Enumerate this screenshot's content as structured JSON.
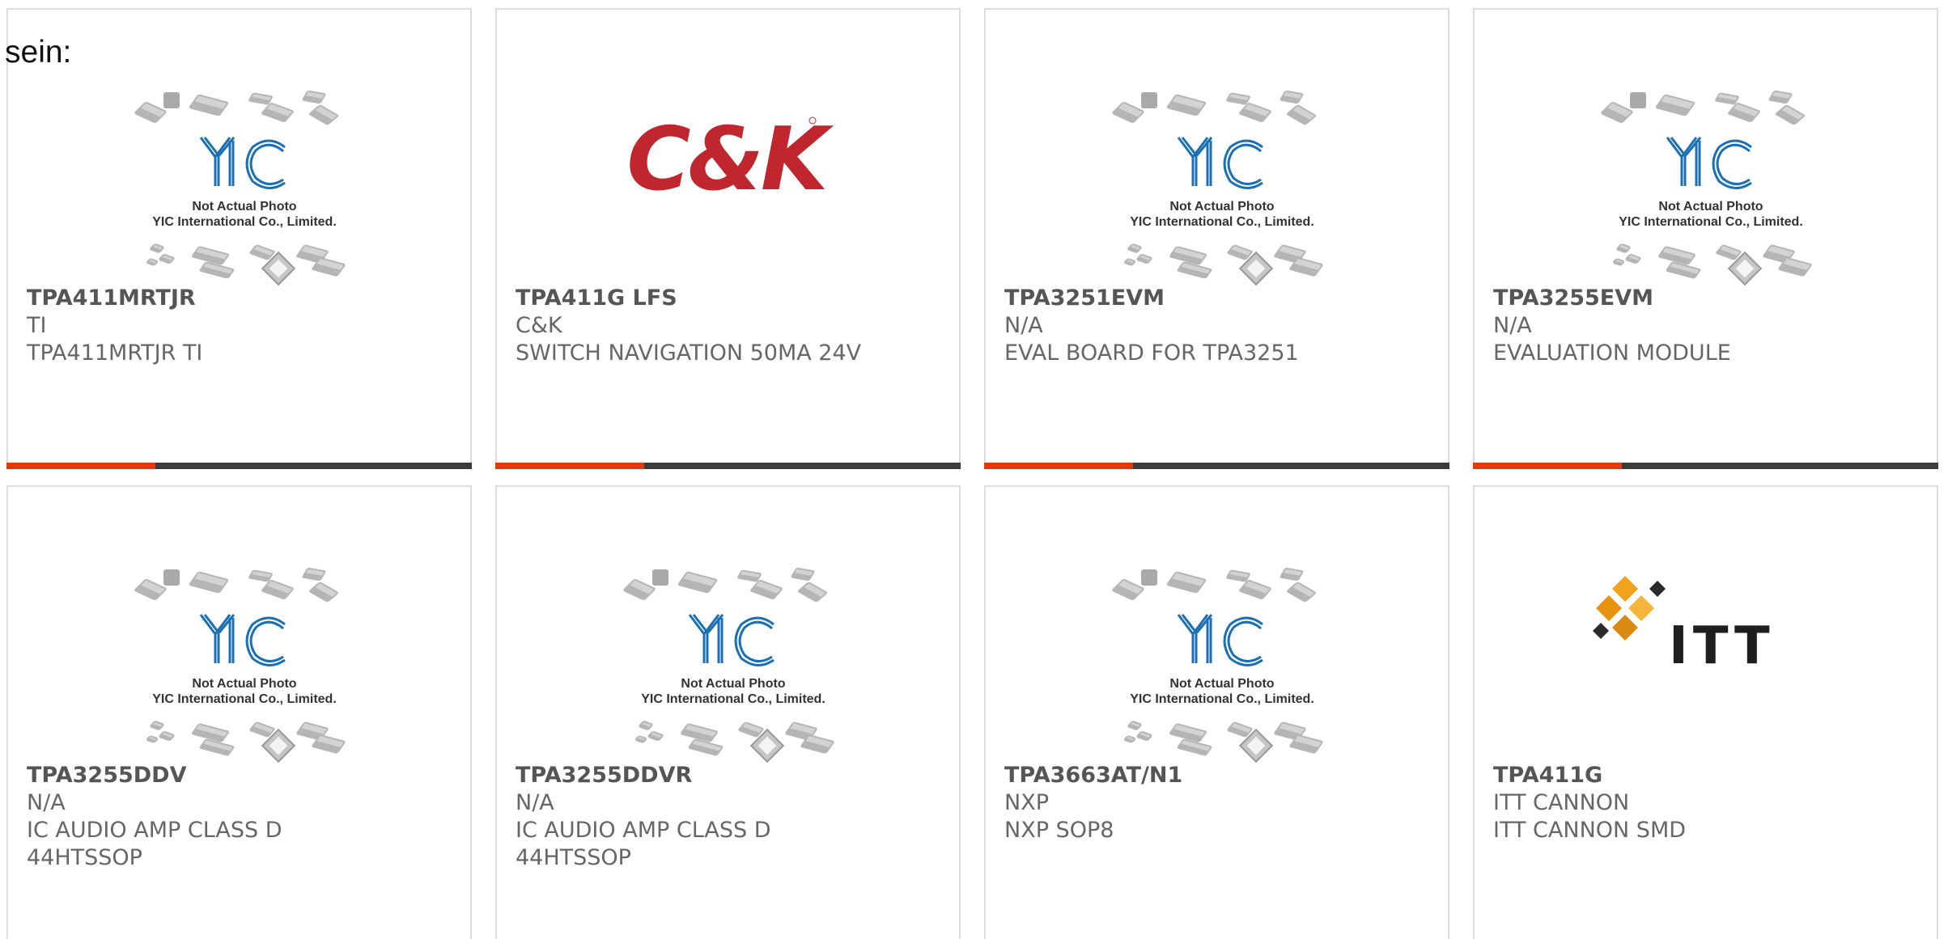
{
  "intro_text": "sein:",
  "placeholder": {
    "line1": "Not Actual Photo",
    "line2": "YIC International Co., Limited.",
    "logo": "YIC"
  },
  "colors": {
    "accent": "#e5380a",
    "bar_dark": "#3b3b3b",
    "yic_blue": "#1a6fb5",
    "ck_red": "#c0262d",
    "itt_gold": "#f0a21b"
  },
  "products": [
    {
      "part_number": "TPA411MRTJR",
      "manufacturer": "TI",
      "description": "TPA411MRTJR TI",
      "image": "yic-placeholder"
    },
    {
      "part_number": "TPA411G LFS",
      "manufacturer": "C&K",
      "description": "SWITCH NAVIGATION 50MA 24V",
      "image": "ck-logo",
      "image_text": "C&K"
    },
    {
      "part_number": "TPA3251EVM",
      "manufacturer": "N/A",
      "description": "EVAL BOARD FOR TPA3251",
      "image": "yic-placeholder"
    },
    {
      "part_number": "TPA3255EVM",
      "manufacturer": "N/A",
      "description": "EVALUATION MODULE",
      "image": "yic-placeholder"
    },
    {
      "part_number": "TPA3255DDV",
      "manufacturer": "N/A",
      "description": "IC AUDIO AMP CLASS D 44HTSSOP",
      "image": "yic-placeholder"
    },
    {
      "part_number": "TPA3255DDVR",
      "manufacturer": "N/A",
      "description": "IC AUDIO AMP CLASS D 44HTSSOP",
      "image": "yic-placeholder"
    },
    {
      "part_number": "TPA3663AT/N1",
      "manufacturer": "NXP",
      "description": "NXP SOP8",
      "image": "yic-placeholder"
    },
    {
      "part_number": "TPA411G",
      "manufacturer": "ITT CANNON",
      "description": "ITT CANNON SMD",
      "image": "itt-logo",
      "image_text": "ITT"
    }
  ]
}
